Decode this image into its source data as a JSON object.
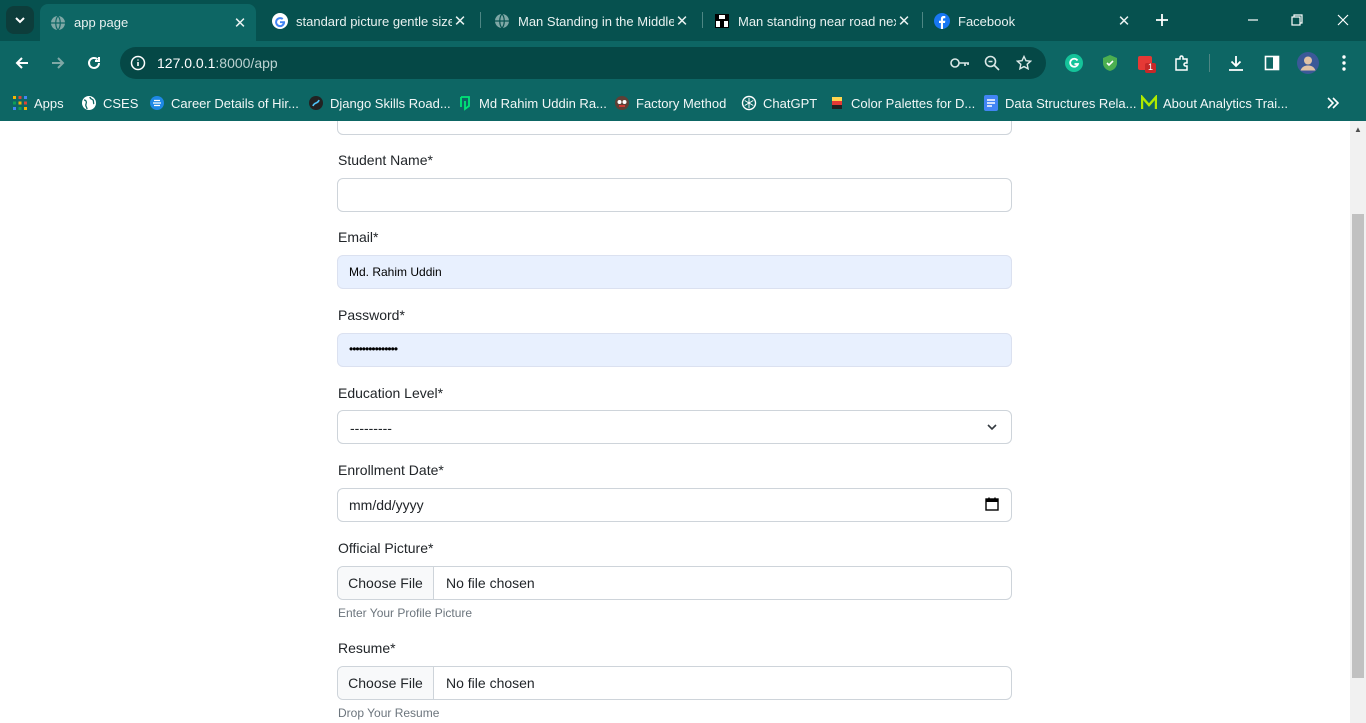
{
  "browser": {
    "tabs": [
      {
        "title": "app page",
        "favicon": "globe-icon",
        "active": true
      },
      {
        "title": "standard picture gentle size",
        "favicon": "google-icon",
        "active": false
      },
      {
        "title": "Man Standing in the Middle",
        "favicon": "globe-icon",
        "active": false
      },
      {
        "title": "Man standing near road nex",
        "favicon": "unsplash-icon",
        "active": false
      },
      {
        "title": "Facebook",
        "favicon": "facebook-icon",
        "active": false
      }
    ],
    "url_host": "127.0.0.1",
    "url_rest": ":8000/app",
    "bookmarks": [
      {
        "label": "Apps",
        "icon": "apps-grid-icon"
      },
      {
        "label": "CSES",
        "icon": "globe-icon"
      },
      {
        "label": "Career Details of Hir...",
        "icon": "career-icon"
      },
      {
        "label": "Django Skills Road...",
        "icon": "roadmap-icon"
      },
      {
        "label": "Md Rahim Uddin Ra...",
        "icon": "profile-site-icon"
      },
      {
        "label": "Factory Method",
        "icon": "refactoring-icon"
      },
      {
        "label": "ChatGPT",
        "icon": "chatgpt-icon"
      },
      {
        "label": "Color Palettes for D...",
        "icon": "palette-icon"
      },
      {
        "label": "Data Structures Rela...",
        "icon": "docs-icon"
      },
      {
        "label": "About Analytics Trai...",
        "icon": "analytics-m-icon"
      }
    ],
    "extension_badge": "1"
  },
  "form": {
    "student_name": {
      "label": "Student Name*",
      "value": ""
    },
    "email": {
      "label": "Email*",
      "value": "Md. Rahim Uddin"
    },
    "password": {
      "label": "Password*",
      "value": "•••••••••••••••"
    },
    "education_level": {
      "label": "Education Level*",
      "value": "---------"
    },
    "enrollment_date": {
      "label": "Enrollment Date*",
      "placeholder": "mm/dd/yyyy"
    },
    "official_picture": {
      "label": "Official Picture*",
      "button": "Choose File",
      "status": "No file chosen",
      "help": "Enter Your Profile Picture"
    },
    "resume": {
      "label": "Resume*",
      "button": "Choose File",
      "status": "No file chosen",
      "help": "Drop Your Resume"
    }
  },
  "colors": {
    "chrome_frame": "#06514f",
    "chrome_toolbar": "#0d6664",
    "autofill_bg": "#e8f0fe"
  }
}
